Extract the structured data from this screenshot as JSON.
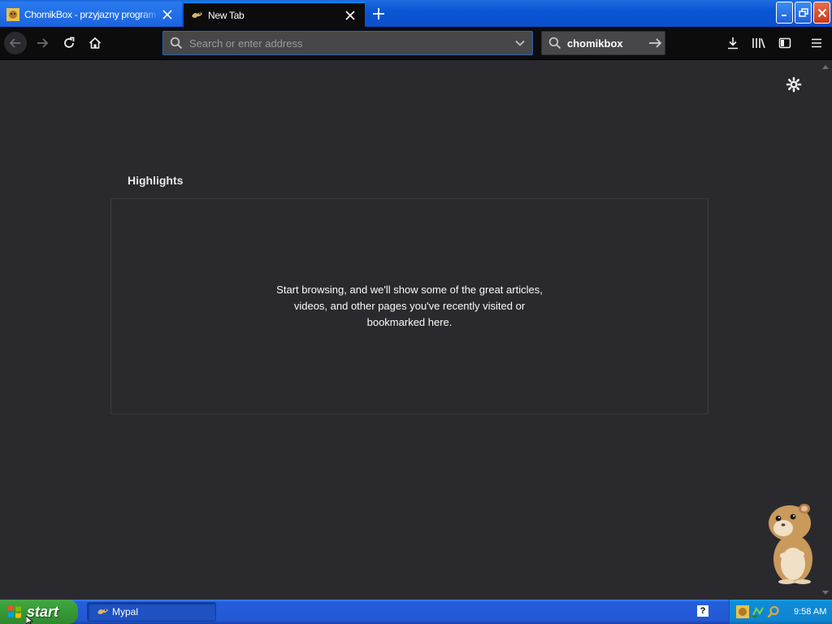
{
  "tabs": [
    {
      "title": "ChomikBox - przyjazny program ułatwiający",
      "active": false,
      "favicon": "chomikbox-favicon"
    },
    {
      "title": "New Tab",
      "active": true,
      "favicon": "mypal-favicon"
    }
  ],
  "toolbar": {
    "url_placeholder": "Search or enter address",
    "search_value": "chomikbox"
  },
  "content": {
    "section_title": "Highlights",
    "empty_message": "Start browsing, and we'll show some of the great articles, videos, and other pages you've recently visited or bookmarked here."
  },
  "taskbar": {
    "start_label": "start",
    "tasks": [
      {
        "label": "Mypal",
        "icon": "mypal-icon"
      }
    ],
    "clock": "9:58 AM"
  },
  "colors": {
    "page_background": "#2a2a2e",
    "toolbar_background": "#0c0c0d",
    "urlbar_background": "#474749",
    "accent": "#0a84ff"
  }
}
